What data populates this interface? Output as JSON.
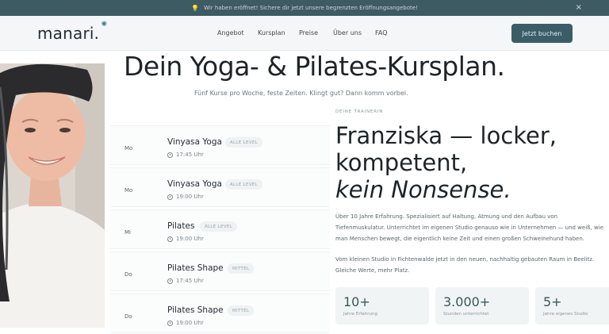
{
  "announcement": {
    "icon": "lightbulb-icon",
    "text": "Wir haben eröffnet! Sichere dir jetzt unsere begrenzten Eröffnungsangebote!",
    "close_label": "×"
  },
  "nav": {
    "logo": "manari.",
    "items": [
      "Angebot",
      "Kursplan",
      "Preise",
      "Über uns",
      "FAQ"
    ],
    "cta": "Jetzt buchen"
  },
  "hero": {
    "headline": "Dein Yoga- & Pilates-Kursplan.",
    "subtitle": "Fünf Kurse pro Woche, feste Zeiten. Klingt gut? Dann komm vorbei."
  },
  "schedule": [
    {
      "day": "Mo",
      "title": "Vinyasa Yoga",
      "level": "ALLE LEVEL",
      "time": "17:45 Uhr"
    },
    {
      "day": "Mo",
      "title": "Vinyasa Yoga",
      "level": "ALLE LEVEL",
      "time": "19:00 Uhr"
    },
    {
      "day": "Mi",
      "title": "Pilates",
      "level": "ALLE LEVEL",
      "time": "19:00 Uhr"
    },
    {
      "day": "Do",
      "title": "Pilates Shape",
      "level": "MITTEL",
      "time": "17:45 Uhr"
    },
    {
      "day": "Do",
      "title": "Pilates Shape",
      "level": "MITTEL",
      "time": "19:00 Uhr"
    }
  ],
  "trainer": {
    "label": "DEINE TRAINERIN",
    "heading_line1": "Franziska — locker,",
    "heading_line2": "kompetent,",
    "heading_line3": "kein Nonsense.",
    "para1_line1": "Über 10 Jahre Erfahrung. Spezialisiert auf Haltung, Atmung und den Aufbau von",
    "para1_line2": "Tiefenmuskulatur. Unterrichtet im eigenen Studio genauso wie in Unternehmen — und weiß, wie",
    "para1_line3": "man Menschen bewegt, die eigentlich keine Zeit und einen großen Schweinehund haben.",
    "para2_line1": "Vom kleinen Studio in Fichtenwalde jetzt in den neuen, nachhaltig gebauten Raum in Beelitz.",
    "para2_line2": "Gleiche Werte, mehr Platz.",
    "stats": [
      {
        "value": "10+",
        "label": "Jahre Erfahrung"
      },
      {
        "value": "3.000+",
        "label": "Stunden unterrichtet"
      },
      {
        "value": "5+",
        "label": "Jahre eigenes Studio"
      }
    ]
  },
  "colors": {
    "announcement_bg": "#3e5a63",
    "cta_bg": "#3b5d67",
    "accent": "#38585f"
  }
}
